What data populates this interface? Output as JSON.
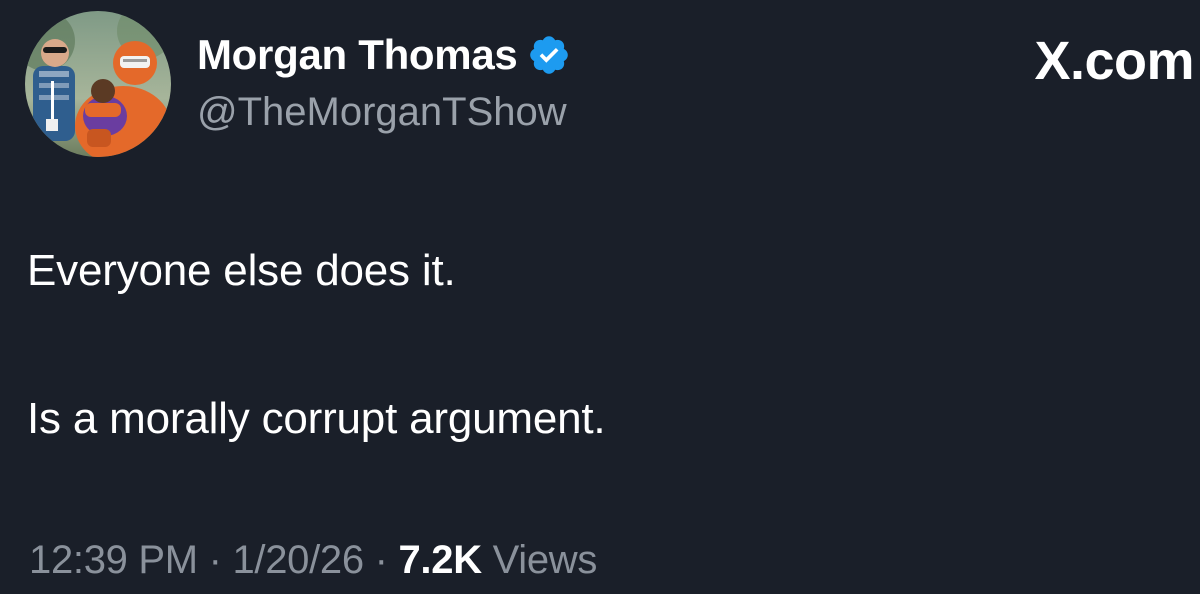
{
  "author": {
    "display_name": "Morgan Thomas",
    "handle": "@TheMorganTShow",
    "verified": true
  },
  "brand": {
    "label": "X.com"
  },
  "tweet": {
    "lines": [
      "Everyone else does it.",
      "Is a morally corrupt argument."
    ]
  },
  "meta": {
    "time": "12:39 PM",
    "separator_1": " · ",
    "date": "1/20/26",
    "separator_2": " · ",
    "views_count": "7.2K",
    "views_label": " Views"
  },
  "colors": {
    "background": "#1a1f29",
    "primary_text": "#ffffff",
    "secondary_text": "#9aa1aa",
    "verified_badge": "#1d9bf0"
  },
  "icons": {
    "avatar": "profile-photo",
    "verified": "verified-badge-icon"
  }
}
